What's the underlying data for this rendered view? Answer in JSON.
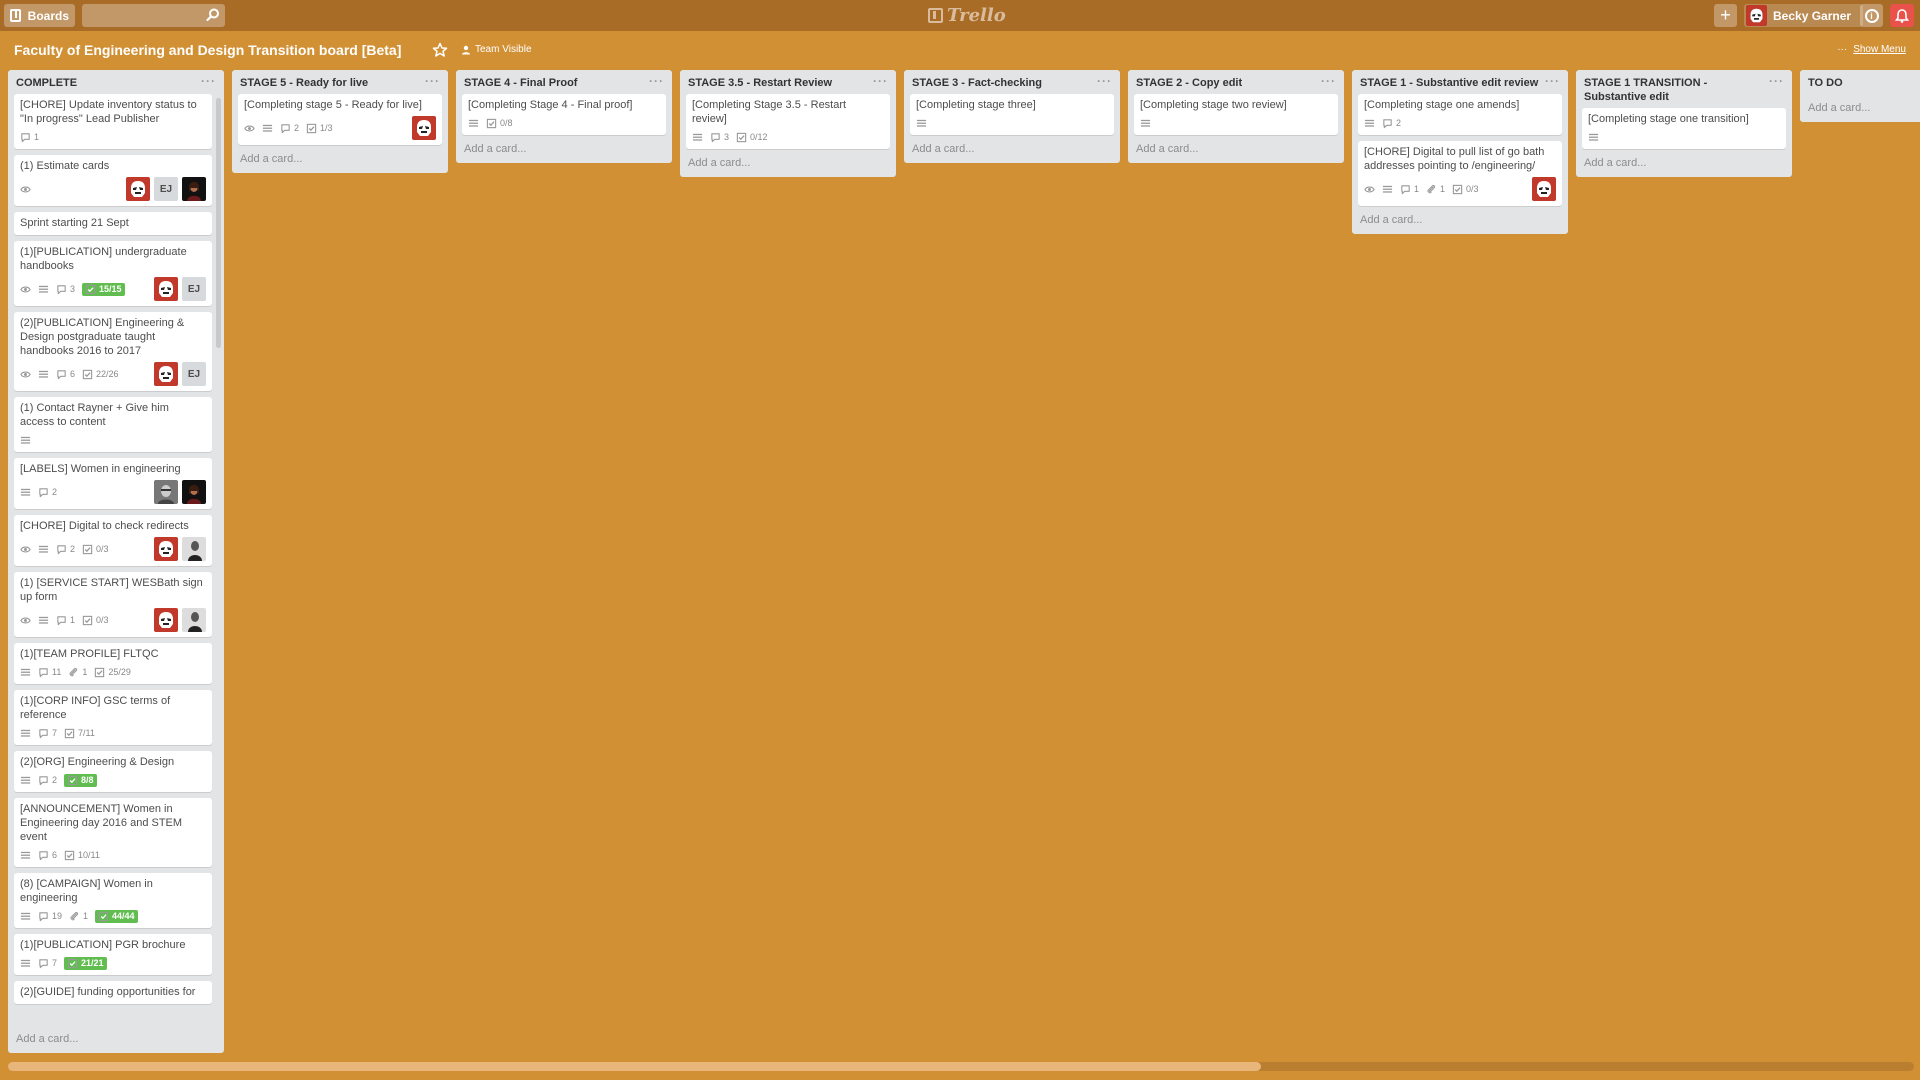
{
  "header": {
    "boards_label": "Boards",
    "search_placeholder": "",
    "logo_text": "Trello",
    "user_name": "Becky Garner",
    "add_symbol": "+",
    "info_symbol": "i"
  },
  "board": {
    "title": "Faculty of Engineering and Design Transition board [Beta]",
    "visibility": "Team Visible",
    "menu_label": "Show Menu",
    "menu_dots": "···"
  },
  "lists": [
    {
      "title": "COMPLETE",
      "add_card": "Add a card...",
      "cards": [
        {
          "title": "[CHORE] Update inventory status to \"In progress\" Lead Publisher",
          "badges": {
            "comments": "1"
          }
        },
        {
          "title": "(1) Estimate cards",
          "badges": {
            "watch": true
          },
          "members": [
            "trooper",
            "EJ",
            "portrait"
          ]
        },
        {
          "title": "Sprint starting 21 Sept"
        },
        {
          "title": "(1)[PUBLICATION] undergraduate handbooks",
          "badges": {
            "watch": true,
            "desc": true,
            "comments": "3",
            "checklist": "15/15",
            "checklist_complete": true
          },
          "members": [
            "trooper",
            "EJ"
          ]
        },
        {
          "title": "(2)[PUBLICATION] Engineering & Design postgraduate taught handbooks 2016 to 2017",
          "badges": {
            "watch": true,
            "desc": true,
            "comments": "6",
            "checklist": "22/26"
          },
          "members": [
            "trooper",
            "EJ"
          ]
        },
        {
          "title": "(1) Contact Rayner + Give him access to content",
          "badges": {
            "desc": true
          }
        },
        {
          "title": "[LABELS] Women in engineering",
          "badges": {
            "desc": true,
            "comments": "2"
          },
          "members": [
            "grey",
            "portrait"
          ]
        },
        {
          "title": "[CHORE] Digital to check redirects",
          "badges": {
            "watch": true,
            "desc": true,
            "comments": "2",
            "checklist": "0/3"
          },
          "members": [
            "trooper",
            "bw"
          ]
        },
        {
          "title": "(1) [SERVICE START] WESBath sign up form",
          "badges": {
            "watch": true,
            "desc": true,
            "comments": "1",
            "checklist": "0/3"
          },
          "members": [
            "trooper",
            "bw"
          ]
        },
        {
          "title": "(1)[TEAM PROFILE] FLTQC",
          "badges": {
            "desc": true,
            "comments": "11",
            "attach": "1",
            "checklist": "25/29"
          }
        },
        {
          "title": "(1)[CORP INFO] GSC terms of reference",
          "badges": {
            "desc": true,
            "comments": "7",
            "checklist": "7/11"
          }
        },
        {
          "title": "(2)[ORG] Engineering & Design",
          "badges": {
            "desc": true,
            "comments": "2",
            "checklist": "8/8",
            "checklist_complete": true
          }
        },
        {
          "title": "[ANNOUNCEMENT] Women in Engineering day 2016 and STEM event",
          "badges": {
            "desc": true,
            "comments": "6",
            "checklist": "10/11"
          }
        },
        {
          "title": "(8) [CAMPAIGN] Women in engineering",
          "badges": {
            "desc": true,
            "comments": "19",
            "attach": "1",
            "checklist": "44/44",
            "checklist_complete": true
          }
        },
        {
          "title": "(1)[PUBLICATION] PGR brochure",
          "badges": {
            "desc": true,
            "comments": "7",
            "checklist": "21/21",
            "checklist_complete": true
          }
        },
        {
          "title": "(2)[GUIDE] funding opportunities for"
        }
      ]
    },
    {
      "title": "STAGE 5 - Ready for live",
      "add_card": "Add a card...",
      "cards": [
        {
          "title": "[Completing stage 5 - Ready for live]",
          "badges": {
            "watch": true,
            "desc": true,
            "comments": "2",
            "checklist": "1/3"
          },
          "members": [
            "trooper"
          ]
        }
      ]
    },
    {
      "title": "STAGE 4 - Final Proof",
      "add_card": "Add a card...",
      "cards": [
        {
          "title": "[Completing Stage 4 - Final proof]",
          "badges": {
            "desc": true,
            "checklist": "0/8"
          }
        }
      ]
    },
    {
      "title": "STAGE 3.5 - Restart Review",
      "add_card": "Add a card...",
      "cards": [
        {
          "title": "[Completing Stage 3.5 - Restart review]",
          "badges": {
            "desc": true,
            "comments": "3",
            "checklist": "0/12"
          }
        }
      ]
    },
    {
      "title": "STAGE 3 - Fact-checking",
      "add_card": "Add a card...",
      "cards": [
        {
          "title": "[Completing stage three]",
          "badges": {
            "desc": true
          }
        }
      ]
    },
    {
      "title": "STAGE 2 - Copy edit",
      "add_card": "Add a card...",
      "cards": [
        {
          "title": "[Completing stage two review]",
          "badges": {
            "desc": true
          }
        }
      ]
    },
    {
      "title": "STAGE 1 - Substantive edit review",
      "add_card": "Add a card...",
      "cards": [
        {
          "title": "[Completing stage one amends]",
          "badges": {
            "desc": true,
            "comments": "2"
          }
        },
        {
          "title": "[CHORE] Digital to pull list of go bath addresses pointing to /engineering/",
          "badges": {
            "watch": true,
            "desc": true,
            "comments": "1",
            "attach": "1",
            "checklist": "0/3"
          },
          "members": [
            "trooper"
          ]
        }
      ]
    },
    {
      "title": "STAGE 1 TRANSITION - Substantive edit",
      "add_card": "Add a card...",
      "cards": [
        {
          "title": "[Completing stage one transition]",
          "badges": {
            "desc": true
          }
        }
      ]
    },
    {
      "title": "TO DO",
      "add_card": "Add a card...",
      "cards": []
    }
  ],
  "colors": {
    "board_bg": "#D29034",
    "header_bg": "#A86C27",
    "list_bg": "#E2E4E6",
    "complete_green": "#61BD4F",
    "notification_red": "#E8524A"
  }
}
